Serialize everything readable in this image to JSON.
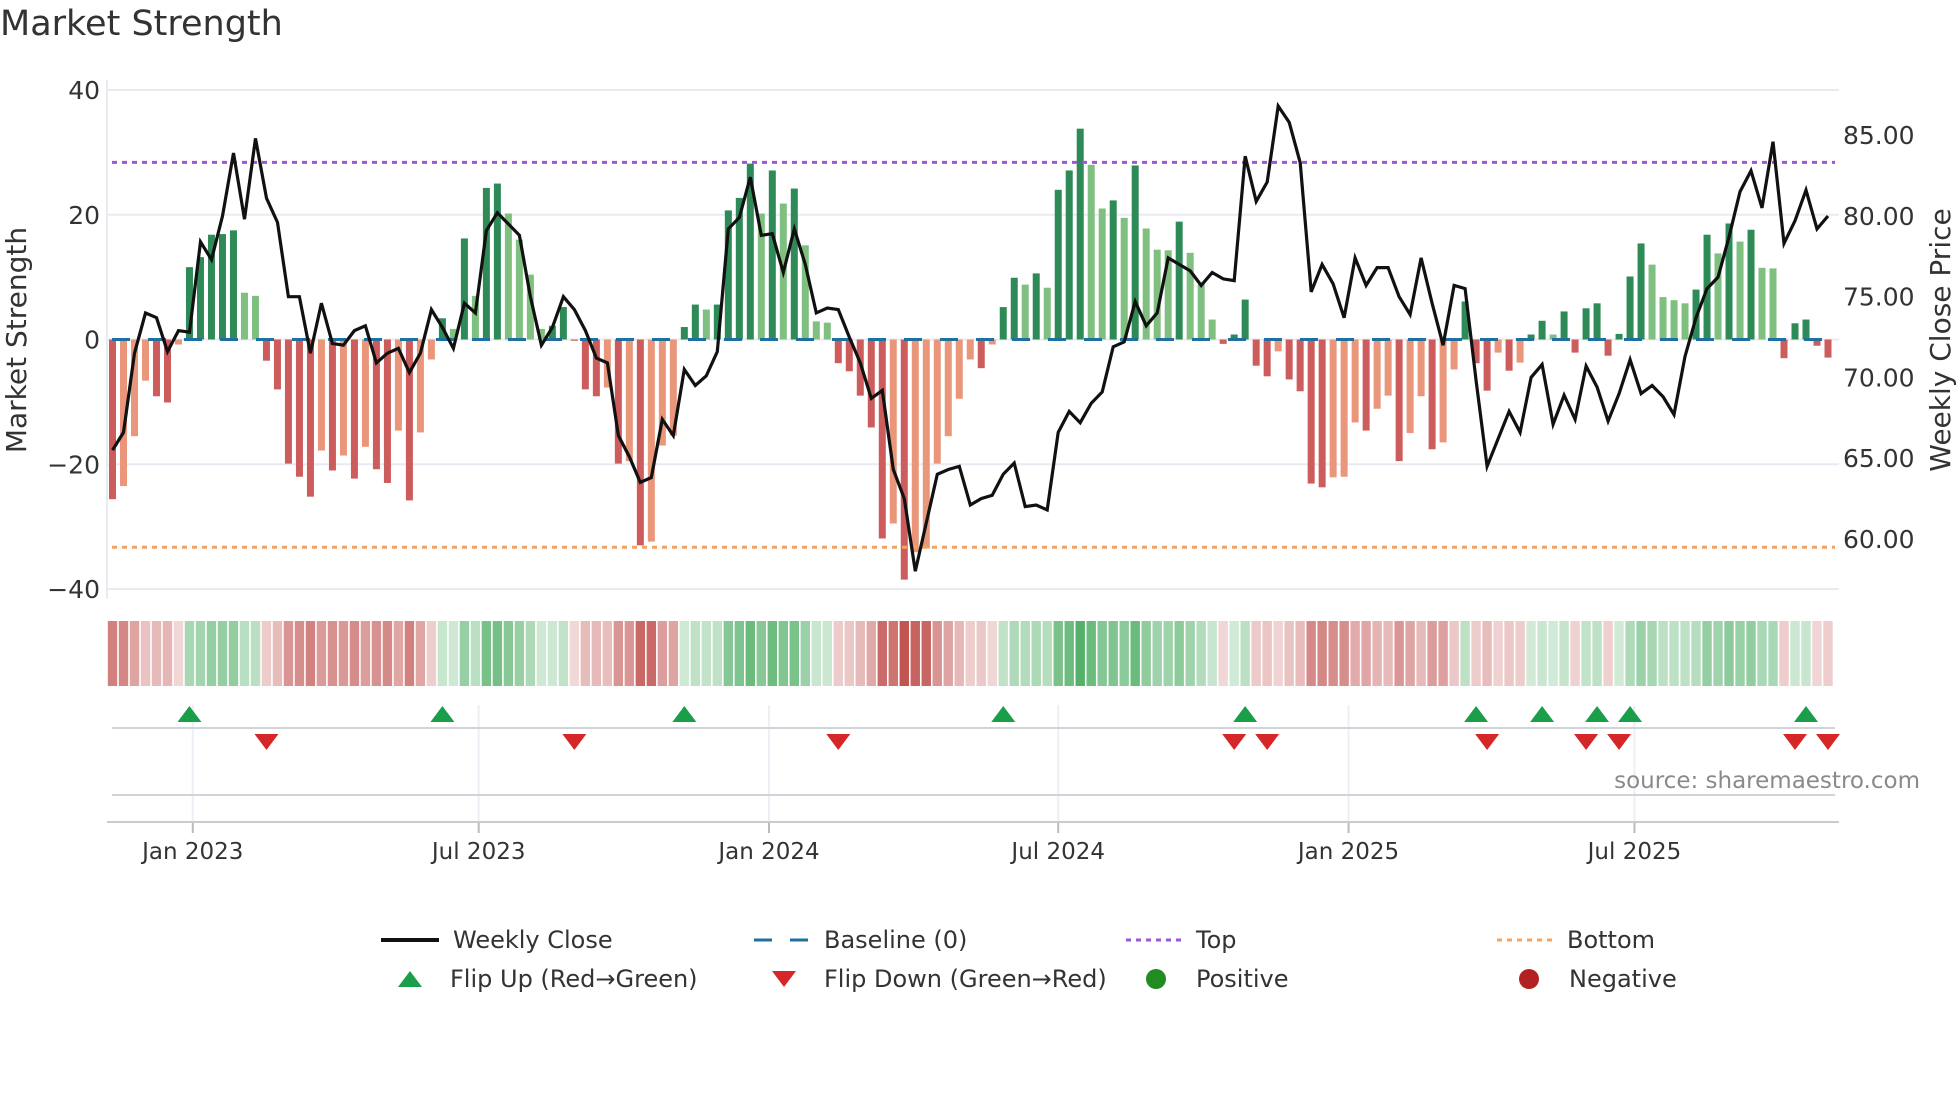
{
  "chart_data": {
    "type": "bar",
    "title": "Market Strength",
    "ylabel": "Market Strength",
    "y2label": "Weekly Close Price",
    "ylim": [
      -40,
      40
    ],
    "y2lim": [
      56.9,
      87.8
    ],
    "yticks": [
      -40,
      -20,
      0,
      20,
      40
    ],
    "ytick_labels": [
      "−40",
      "−20",
      "0",
      "20",
      "40"
    ],
    "y2ticks": [
      60,
      65,
      70,
      75,
      80,
      85
    ],
    "y2tick_labels": [
      "60.00",
      "65.00",
      "70.00",
      "75.00",
      "80.00",
      "85.00"
    ],
    "x_unit": "week index",
    "xlim": [
      -0.5,
      157
    ],
    "xticks": [
      {
        "label": "Jan 2023",
        "week": 7.3
      },
      {
        "label": "Jul 2023",
        "week": 33.3
      },
      {
        "label": "Jan 2024",
        "week": 59.7
      },
      {
        "label": "Jul 2024",
        "week": 86.0
      },
      {
        "label": "Jan 2025",
        "week": 112.4
      },
      {
        "label": "Jul 2025",
        "week": 138.4
      }
    ],
    "top_level": 28.4,
    "bottom_level": -33.3,
    "baseline": 0,
    "strength": [
      -25.6,
      -23.5,
      -15.5,
      -6.6,
      -9.1,
      -10.1,
      -0.8,
      11.6,
      13.2,
      16.8,
      16.9,
      17.5,
      7.5,
      7.0,
      -3.4,
      -8.0,
      -19.9,
      -22,
      -25.2,
      -17.8,
      -21,
      -18.6,
      -22.3,
      -17.2,
      -20.8,
      -23,
      -14.6,
      -25.8,
      -14.9,
      -3.2,
      3.4,
      1.7,
      16.2,
      7,
      24.3,
      25,
      20.2,
      16,
      10.4,
      1.7,
      2.2,
      5.2,
      -0.2,
      -8,
      -9.1,
      -7.7,
      -19.9,
      -19.5,
      -33,
      -32.4,
      -17,
      -15.4,
      2,
      5.6,
      4.8,
      5.6,
      20.7,
      22.7,
      28.2,
      20.2,
      27.1,
      21.8,
      24.2,
      15.1,
      2.9,
      2.7,
      -3.8,
      -5.1,
      -9,
      -14.1,
      -31.9,
      -29.5,
      -38.5,
      -34.1,
      -33.5,
      -19.9,
      -15.5,
      -9.5,
      -3.2,
      -4.6,
      -0.8,
      5.2,
      9.9,
      8.8,
      10.6,
      8.3,
      24,
      27.1,
      33.8,
      28,
      21,
      22.3,
      19.5,
      27.9,
      17.8,
      14.4,
      14.3,
      18.9,
      13.9,
      8.8,
      3.2,
      -0.7,
      0.8,
      6.4,
      -4.2,
      -5.9,
      -1.9,
      -6.4,
      -8.3,
      -23.1,
      -23.7,
      -22.1,
      -22,
      -13.3,
      -14.6,
      -11.1,
      -9,
      -19.5,
      -15,
      -9.1,
      -17.6,
      -16.5,
      -4.8,
      6.1,
      -3.8,
      -8.2,
      -2.1,
      -5,
      -3.7,
      0.8,
      3.0,
      0.8,
      4.5,
      -2.1,
      5.0,
      5.8,
      -2.6,
      0.9,
      10.1,
      15.4,
      12,
      6.8,
      6.3,
      5.8,
      8,
      16.8,
      13.8,
      18.6,
      15.7,
      17.6,
      11.5,
      11.4,
      -3,
      2.6,
      3.2,
      -1,
      -2.9
    ],
    "weekly_close": [
      65.5,
      66.6,
      71.5,
      74.0,
      73.7,
      71.6,
      72.9,
      72.8,
      78.4,
      77.3,
      80.0,
      83.9,
      79.8,
      84.8,
      81.1,
      79.6,
      75.0,
      75.0,
      71.5,
      74.6,
      72.1,
      72.0,
      72.9,
      73.2,
      70.9,
      71.5,
      71.8,
      70.3,
      71.5,
      74.2,
      73.1,
      71.8,
      74.6,
      74.0,
      79.1,
      80.2,
      79.5,
      78.8,
      75.0,
      72.0,
      73.1,
      75.0,
      74.2,
      72.9,
      71.2,
      70.9,
      66.4,
      65.1,
      63.5,
      63.8,
      67.4,
      66.4,
      70.5,
      69.5,
      70.1,
      71.6,
      79.2,
      79.9,
      82.4,
      78.8,
      78.9,
      76.5,
      79.2,
      77.0,
      74.0,
      74.3,
      74.2,
      72.5,
      70.9,
      68.7,
      69.2,
      64.3,
      62.5,
      58.0,
      61.0,
      64.0,
      64.3,
      64.5,
      62.1,
      62.5,
      62.7,
      64.0,
      64.7,
      62.0,
      62.1,
      61.8,
      66.6,
      67.9,
      67.2,
      68.4,
      69.1,
      71.9,
      72.2,
      74.7,
      73.2,
      74.0,
      77.4,
      77.0,
      76.6,
      75.7,
      76.5,
      76.1,
      76.0,
      83.7,
      80.9,
      82.1,
      86.8,
      85.8,
      83.3,
      75.3,
      77.0,
      75.8,
      73.7,
      77.4,
      75.7,
      76.8,
      76.8,
      75.0,
      73.9,
      77.4,
      74.6,
      72.0,
      75.7,
      75.5,
      69.8,
      64.5,
      66.2,
      67.9,
      66.6,
      70.0,
      70.8,
      67.1,
      68.9,
      67.4,
      70.7,
      69.4,
      67.3,
      69.0,
      71.1,
      69.0,
      69.5,
      68.8,
      67.7,
      71.3,
      73.7,
      75.5,
      76.2,
      78.7,
      81.5,
      82.8,
      80.5,
      84.6,
      78.3,
      79.7,
      81.6,
      79.2,
      80.0
    ],
    "flip_up_weeks": [
      7,
      30,
      52,
      81,
      103,
      124,
      130,
      135,
      138,
      154
    ],
    "flip_down_weeks": [
      14,
      42,
      66,
      102,
      105,
      125,
      134,
      137,
      153,
      156
    ],
    "legend": {
      "placement": "bottom",
      "entries": [
        {
          "key": "close",
          "label": "Weekly Close"
        },
        {
          "key": "baseline",
          "label": "Baseline (0)"
        },
        {
          "key": "top",
          "label": "Top"
        },
        {
          "key": "bottom",
          "label": "Bottom"
        },
        {
          "key": "flip_up",
          "label": "Flip Up (Red→Green)"
        },
        {
          "key": "flip_down",
          "label": "Flip Down (Green→Red)"
        },
        {
          "key": "positive",
          "label": "Positive"
        },
        {
          "key": "negative",
          "label": "Negative"
        }
      ]
    },
    "colors": {
      "pos_strong": "#2e8b57",
      "pos_weak": "#7fbf7f",
      "neg_strong": "#cd5c5c",
      "neg_weak": "#e9967a",
      "close": "#111111",
      "baseline": "#1f6f9f",
      "top": "#9b59d6",
      "bottom": "#f4a460",
      "flip_up": "#1a9e4a",
      "flip_down": "#d62728",
      "positive": "#228b22",
      "negative": "#b22222",
      "heat_pos": "#3da655",
      "heat_neg": "#c0504d",
      "grid": "#e8ebf2"
    },
    "source": "source: sharemaestro.com"
  }
}
